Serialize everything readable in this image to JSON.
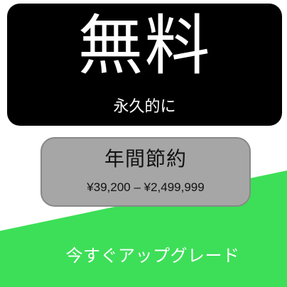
{
  "hero": {
    "title": "無料",
    "subtitle": "永久的に"
  },
  "savings": {
    "title": "年間節約",
    "range": "¥39,200 – ¥2,499,999"
  },
  "cta": {
    "label": "今すぐアップグレード"
  },
  "colors": {
    "hero_bg": "#000000",
    "savings_bg": "#a6a6a6",
    "accent_green": "#3ddf58",
    "text_light": "#ffffff"
  }
}
